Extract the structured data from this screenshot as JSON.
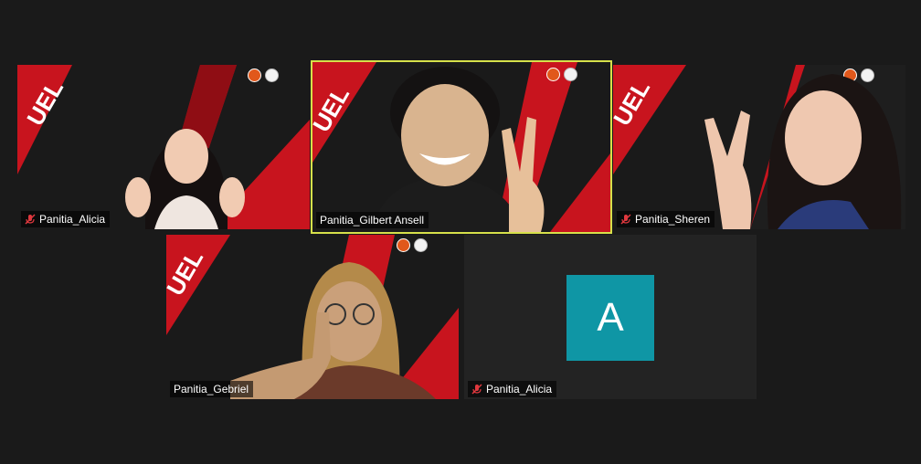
{
  "participants": [
    {
      "name": "Panitia_Alicia",
      "muted": true,
      "video": true
    },
    {
      "name": "Panitia_Gilbert Ansell",
      "muted": false,
      "video": true,
      "active_speaker": true
    },
    {
      "name": "Panitia_Sheren",
      "muted": true,
      "video": true
    },
    {
      "name": "Panitia_Gebriel",
      "muted": false,
      "video": true
    },
    {
      "name": "Panitia_Alicia",
      "muted": true,
      "video": false,
      "avatar_letter": "A",
      "avatar_color": "#0f96a5"
    }
  ],
  "colors": {
    "background": "#1a1a1a",
    "active_speaker_border": "#d6e04a",
    "backdrop_red": "#c8141e",
    "muted_icon": "#e0383e"
  },
  "icons": {
    "muted": "mic-off-icon",
    "badge_left": "orange-logo-badge-icon",
    "badge_right": "white-logo-badge-icon"
  }
}
